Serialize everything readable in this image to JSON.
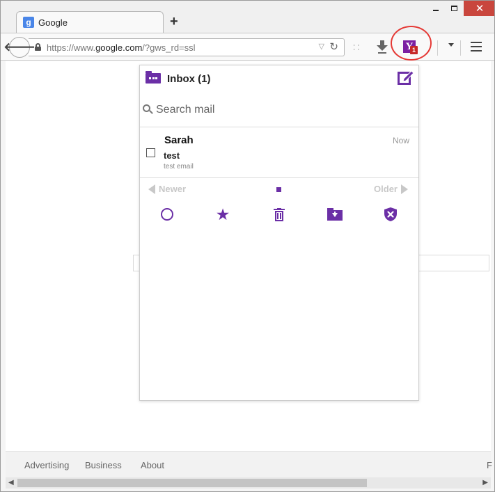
{
  "browser": {
    "tab_title": "Google",
    "tab_favicon_letter": "g",
    "new_tab_symbol": "+",
    "url_prefix": "https://www.",
    "url_host": "google.com",
    "url_suffix": "/?gws_rd=ssl",
    "window_close_symbol": "✕"
  },
  "extension": {
    "name": "Yahoo Mail",
    "badge_letter": "Y",
    "badge_count": "1"
  },
  "popup": {
    "title": "Inbox (1)",
    "search_placeholder": "Search mail",
    "messages": [
      {
        "sender": "Sarah",
        "time": "Now",
        "subject": "test",
        "snippet": "test email",
        "checked": false
      }
    ],
    "pager": {
      "newer_label": "Newer",
      "older_label": "Older"
    },
    "actions": [
      "mark-read",
      "star",
      "delete",
      "move-to-folder",
      "spam"
    ],
    "accent_color": "#6b2fa6"
  },
  "footer": {
    "links": [
      "Advertising",
      "Business",
      "About"
    ],
    "cut_text": "F"
  }
}
